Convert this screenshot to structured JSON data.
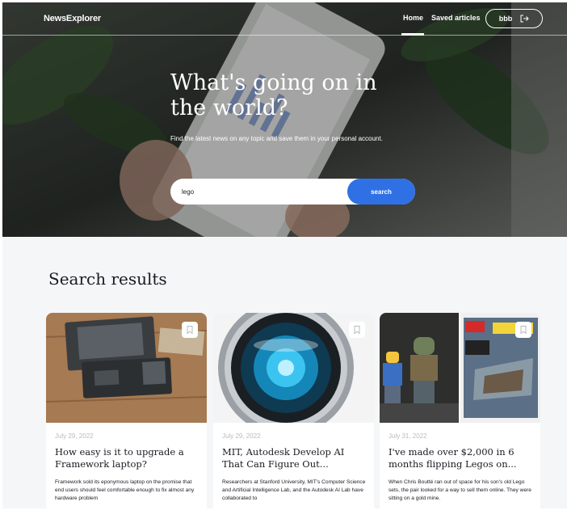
{
  "header": {
    "logo": "NewsExplorer",
    "nav": {
      "home": "Home",
      "saved": "Saved articles"
    },
    "user": {
      "name": "bbb",
      "icon": "logout-icon"
    }
  },
  "hero": {
    "title": "What's going on in the world?",
    "subtitle": "Find the latest news on any topic and save them in your personal account.",
    "search": {
      "value": "lego",
      "button": "search"
    }
  },
  "results": {
    "title": "Search results",
    "cards": [
      {
        "date": "July 29, 2022",
        "title": "How easy is it to upgrade a Framework laptop?",
        "text": "Framework sold its eponymous laptop on the promise that end users should feel comfortable enough to fix almost any hardware problem",
        "save_icon": "bookmark-icon"
      },
      {
        "date": "July 29, 2022",
        "title": "MIT, Autodesk Develop AI That Can Figure Out...",
        "text": "Researchers at Stanford University, MIT's Computer Science and Artificial Intelligence Lab, and the Autodesk AI Lab have collaborated to",
        "save_icon": "bookmark-icon"
      },
      {
        "date": "July 31, 2022",
        "title": "I've made over $2,000 in 6 months flipping Legos on...",
        "text": "When Chris Boutté ran out of space for his son's old Lego sets, the pair looked for a way to sell them online. They were sitting on a gold mine.",
        "save_icon": "bookmark-icon"
      }
    ]
  },
  "colors": {
    "accent": "#2f71e5",
    "background": "#f5f6f7",
    "text": "#1a1b22",
    "muted": "#b6bcbf"
  }
}
